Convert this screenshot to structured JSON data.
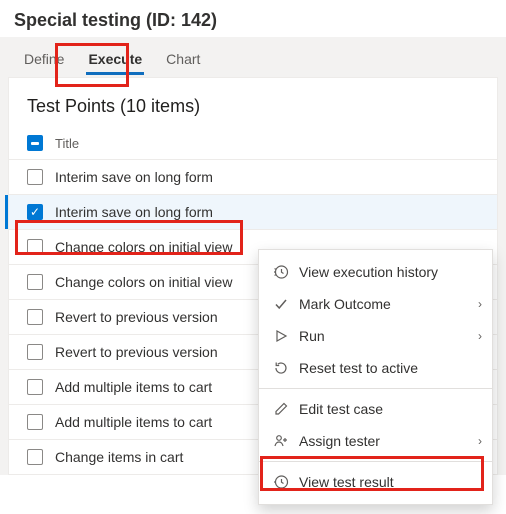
{
  "header": {
    "title": "Special testing (ID: 142)"
  },
  "tabs": {
    "define": "Define",
    "execute": "Execute",
    "chart": "Chart"
  },
  "panel": {
    "title": "Test Points (10 items)",
    "column_title": "Title"
  },
  "rows": [
    {
      "title": "Interim save on long form"
    },
    {
      "title": "Interim save on long form"
    },
    {
      "title": "Change colors on initial view"
    },
    {
      "title": "Change colors on initial view"
    },
    {
      "title": "Revert to previous version"
    },
    {
      "title": "Revert to previous version"
    },
    {
      "title": "Add multiple items to cart"
    },
    {
      "title": "Add multiple items to cart"
    },
    {
      "title": "Change items in cart"
    }
  ],
  "menu": {
    "view_history": "View execution history",
    "mark_outcome": "Mark Outcome",
    "run": "Run",
    "reset": "Reset test to active",
    "edit": "Edit test case",
    "assign": "Assign tester",
    "view_result": "View test result"
  }
}
